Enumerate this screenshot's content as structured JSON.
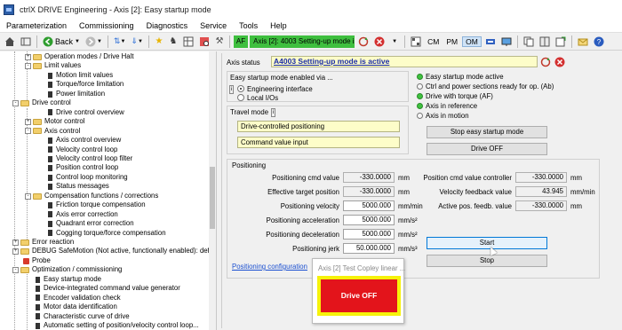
{
  "window": {
    "title": "ctrlX DRIVE Engineering - Axis [2]: Easy startup mode"
  },
  "menu": [
    "Parameterization",
    "Commissioning",
    "Diagnostics",
    "Service",
    "Tools",
    "Help"
  ],
  "toolbar": {
    "back_label": "Back",
    "af_label": "AF",
    "axis_status": "Axis [2]: 4003 Setting-up mode is a",
    "cm_label": "CM",
    "pm_label": "PM",
    "om_label": "OM"
  },
  "tree": [
    {
      "label": "Operation modes / Drive Halt",
      "level": 2,
      "kind": "folder",
      "exp": "+"
    },
    {
      "label": "Limit values",
      "level": 2,
      "kind": "folder",
      "exp": "-"
    },
    {
      "label": "Motion limit values",
      "level": 3,
      "kind": "leaf"
    },
    {
      "label": "Torque/force limitation",
      "level": 3,
      "kind": "leaf"
    },
    {
      "label": "Power limitation",
      "level": 3,
      "kind": "leaf"
    },
    {
      "label": "Drive control",
      "level": 1,
      "kind": "folder",
      "exp": "-"
    },
    {
      "label": "Drive control overview",
      "level": 3,
      "kind": "leaf"
    },
    {
      "label": "Motor control",
      "level": 2,
      "kind": "folder",
      "exp": "+"
    },
    {
      "label": "Axis control",
      "level": 2,
      "kind": "folder",
      "exp": "-"
    },
    {
      "label": "Axis control overview",
      "level": 3,
      "kind": "leaf"
    },
    {
      "label": "Velocity control loop",
      "level": 3,
      "kind": "leaf"
    },
    {
      "label": "Velocity control loop filter",
      "level": 3,
      "kind": "leaf"
    },
    {
      "label": "Position control loop",
      "level": 3,
      "kind": "leaf"
    },
    {
      "label": "Control loop monitoring",
      "level": 3,
      "kind": "leaf"
    },
    {
      "label": "Status messages",
      "level": 3,
      "kind": "leaf"
    },
    {
      "label": "Compensation functions / corrections",
      "level": 2,
      "kind": "folder",
      "exp": "-"
    },
    {
      "label": "Friction torque compensation",
      "level": 3,
      "kind": "leaf"
    },
    {
      "label": "Axis error correction",
      "level": 3,
      "kind": "leaf"
    },
    {
      "label": "Quadrant error correction",
      "level": 3,
      "kind": "leaf"
    },
    {
      "label": "Cogging torque/force compensation",
      "level": 3,
      "kind": "leaf"
    },
    {
      "label": "Error reaction",
      "level": 1,
      "kind": "folder",
      "exp": "+"
    },
    {
      "label": "DEBUG SafeMotion (Not active, functionally enabled): def",
      "level": 1,
      "kind": "folder",
      "exp": "+"
    },
    {
      "label": "Probe",
      "level": 1,
      "kind": "leaf-red"
    },
    {
      "label": "Optimization / commissioning",
      "level": 1,
      "kind": "folder",
      "exp": "-"
    },
    {
      "label": "Easy startup mode",
      "level": 2,
      "kind": "leaf"
    },
    {
      "label": "Device-integrated command value generator",
      "level": 2,
      "kind": "leaf"
    },
    {
      "label": "Encoder validation check",
      "level": 2,
      "kind": "leaf"
    },
    {
      "label": "Motor data identification",
      "level": 2,
      "kind": "leaf"
    },
    {
      "label": "Characteristic curve of drive",
      "level": 2,
      "kind": "leaf"
    },
    {
      "label": "Automatic setting of position/velocity control loop...",
      "level": 2,
      "kind": "leaf"
    }
  ],
  "axis_status": {
    "label": "Axis status",
    "value": "A4003 Setting-up mode is active"
  },
  "enabled_via": {
    "title": "Easy startup mode enabled via ...",
    "options": [
      "Engineering interface",
      "Local I/Os"
    ],
    "selected": 0
  },
  "status_leds": [
    {
      "label": "Easy startup mode active",
      "on": true
    },
    {
      "label": "Ctrl and power sections ready for op. (Ab)",
      "on": false
    },
    {
      "label": "Drive with torque (AF)",
      "on": true
    },
    {
      "label": "Axis in reference",
      "on": true
    },
    {
      "label": "Axis in motion",
      "on": false
    }
  ],
  "travel_mode": {
    "label": "Travel mode",
    "fields": [
      "Drive-controlled positioning",
      "Command value input"
    ]
  },
  "buttons": {
    "stop_easy": "Stop easy startup mode",
    "drive_off": "Drive OFF",
    "start": "Start",
    "stop": "Stop"
  },
  "positioning": {
    "title": "Positioning",
    "left": [
      {
        "label": "Positioning cmd value",
        "value": "-330.0000",
        "unit": "mm"
      },
      {
        "label": "Effective target position",
        "value": "-330.0000",
        "unit": "mm"
      },
      {
        "label": "Positioning velocity",
        "value": "5000.000",
        "unit": "mm/min"
      },
      {
        "label": "Positioning acceleration",
        "value": "5000.000",
        "unit": "mm/s²"
      },
      {
        "label": "Positioning deceleration",
        "value": "5000.000",
        "unit": "mm/s²"
      },
      {
        "label": "Positioning jerk",
        "value": "50.000.000",
        "unit": "mm/s³"
      }
    ],
    "right": [
      {
        "label": "Position cmd value controller",
        "value": "-330.0000",
        "unit": "mm"
      },
      {
        "label": "Velocity feedback value",
        "value": "43.945",
        "unit": "mm/min"
      },
      {
        "label": "Active pos. feedb. value",
        "value": "-330.0000",
        "unit": "mm"
      }
    ],
    "config_link": "Positioning configuration"
  },
  "popup": {
    "title": "Axis [2] Test Copley linear ...",
    "button": "Drive OFF"
  }
}
